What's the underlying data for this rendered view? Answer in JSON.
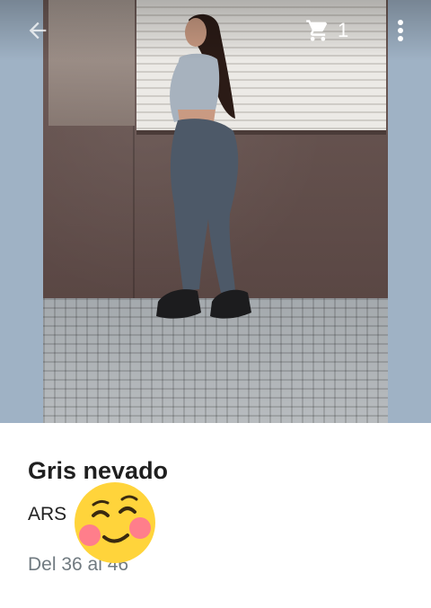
{
  "toolbar": {
    "back_icon": "arrow-left-icon",
    "cart_icon": "shopping-cart-icon",
    "cart_count": "1",
    "more_icon": "more-vertical-icon"
  },
  "product": {
    "image_desc": "product-photo",
    "title": "Gris nevado",
    "price_text": "ARS",
    "sizes_text": "Del 36 al 46"
  },
  "overlay": {
    "emoji_icon": "smiling-face-emoji"
  },
  "colors": {
    "side_bg": "#9fb2c5",
    "title": "#1f1f1f",
    "muted": "#707a80"
  }
}
